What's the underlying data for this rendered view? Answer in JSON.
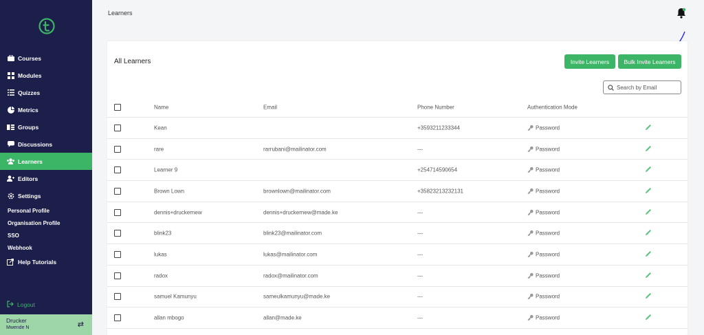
{
  "sidebar": {
    "nav": [
      {
        "label": "Courses",
        "icon": "briefcase-icon"
      },
      {
        "label": "Modules",
        "icon": "grid-icon"
      },
      {
        "label": "Quizzes",
        "icon": "list-icon"
      },
      {
        "label": "Metrics",
        "icon": "pie-chart-icon"
      },
      {
        "label": "Groups",
        "icon": "id-card-icon"
      },
      {
        "label": "Discussions",
        "icon": "chat-icon"
      },
      {
        "label": "Learners",
        "icon": "users-icon",
        "active": true
      },
      {
        "label": "Editors",
        "icon": "user-plus-icon"
      },
      {
        "label": "Settings",
        "icon": "gear-icon"
      }
    ],
    "settings_sub": [
      "Personal Profile",
      "Organisation Profile",
      "SSO",
      "Webhook"
    ],
    "help": "Help Tutorials",
    "logout": "Logout",
    "user": {
      "name": "Drucker",
      "sub": "Mwende N"
    }
  },
  "header": {
    "breadcrumb": "Learners"
  },
  "card": {
    "title": "All Learners",
    "invite_label": "Invite Learners",
    "bulk_label": "Bulk Invite Learners",
    "search_placeholder": "Search by Email"
  },
  "table": {
    "columns": {
      "name": "Name",
      "email": "Email",
      "phone": "Phone Number",
      "auth": "Authentication Mode"
    },
    "rows": [
      {
        "name": "Kean",
        "email": "",
        "phone": "+3593211233344",
        "auth": "Password"
      },
      {
        "name": "rare",
        "email": "rarrubani@mailinator.com",
        "phone": "---",
        "auth": "Password"
      },
      {
        "name": "Learner 9",
        "email": "",
        "phone": "+254714590654",
        "auth": "Password"
      },
      {
        "name": "Brown Lown",
        "email": "brownlown@mailinator.com",
        "phone": "+35823213232131",
        "auth": "Password"
      },
      {
        "name": "dennis+druckernew",
        "email": "dennis+druckernew@made.ke",
        "phone": "---",
        "auth": "Password"
      },
      {
        "name": "blink23",
        "email": "blink23@mailinator.com",
        "phone": "---",
        "auth": "Password"
      },
      {
        "name": "lukas",
        "email": "lukas@mailinator.com",
        "phone": "---",
        "auth": "Password"
      },
      {
        "name": "radox",
        "email": "radox@mailinator.com",
        "phone": "---",
        "auth": "Password"
      },
      {
        "name": "samuel Kamunyu",
        "email": "sameulkamunyu@made.ke",
        "phone": "---",
        "auth": "Password"
      },
      {
        "name": "allan mbogo",
        "email": "allan@made.ke",
        "phone": "---",
        "auth": "Password"
      }
    ]
  },
  "colors": {
    "sidebar": "#1c1f4a",
    "accent": "#3cb567",
    "user_box": "#9fd6a7",
    "annotation": "#1a1aff"
  }
}
